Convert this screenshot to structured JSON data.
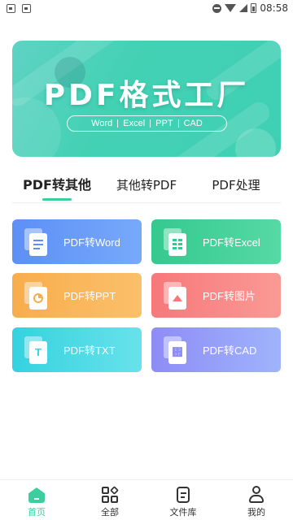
{
  "status_bar": {
    "time": "08:58"
  },
  "banner": {
    "title": "PDF格式工厂",
    "tags": [
      "Word",
      "Excel",
      "PPT",
      "CAD"
    ]
  },
  "tabs": [
    {
      "label": "PDF转其他",
      "active": true
    },
    {
      "label": "其他转PDF",
      "active": false
    },
    {
      "label": "PDF处理",
      "active": false
    }
  ],
  "cards": [
    {
      "label": "PDF转Word",
      "icon": "word-doc-icon"
    },
    {
      "label": "PDF转Excel",
      "icon": "excel-sheet-icon"
    },
    {
      "label": "PDF转PPT",
      "icon": "ppt-chart-icon"
    },
    {
      "label": "PDF转图片",
      "icon": "image-icon",
      "glyph": ""
    },
    {
      "label": "PDF转TXT",
      "icon": "txt-icon",
      "glyph": "T"
    },
    {
      "label": "PDF转CAD",
      "icon": "cad-icon",
      "glyph": "᎟"
    }
  ],
  "bottom_nav": [
    {
      "label": "首页",
      "icon": "home-icon",
      "active": true
    },
    {
      "label": "全部",
      "icon": "apps-icon",
      "active": false
    },
    {
      "label": "文件库",
      "icon": "file-library-icon",
      "active": false
    },
    {
      "label": "我的",
      "icon": "profile-icon",
      "active": false
    }
  ],
  "colors": {
    "accent": "#3ccf9e",
    "word": "#5d8ff6",
    "excel": "#35c98f",
    "ppt": "#f8ad4c",
    "image": "#f7787a",
    "txt": "#35d2e0",
    "cad": "#8e8cf6"
  }
}
